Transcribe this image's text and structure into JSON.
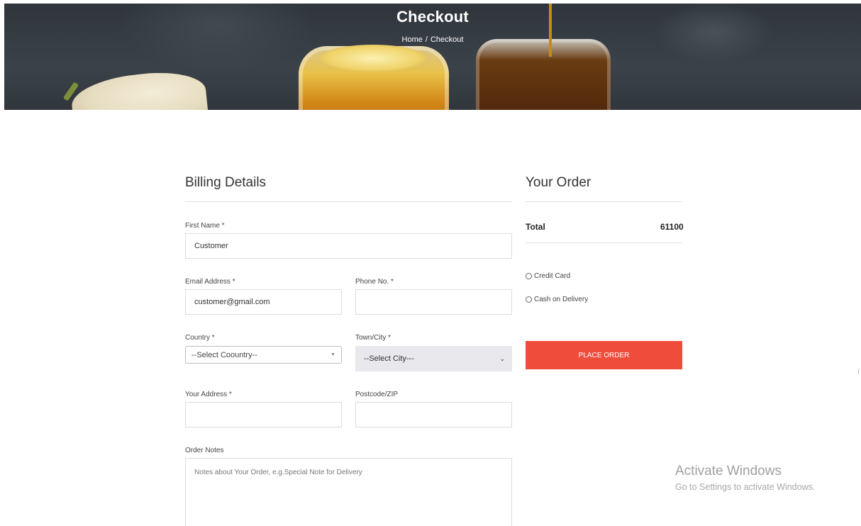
{
  "header": {
    "title": "Checkout",
    "breadcrumb": {
      "home": "Home",
      "separator": "/",
      "current": "Checkout"
    }
  },
  "billing": {
    "heading": "Billing Details",
    "first_name": {
      "label": "First Name *",
      "value": "Customer"
    },
    "email": {
      "label": "Email Address *",
      "value": "customer@gmail.com"
    },
    "phone": {
      "label": "Phone No. *",
      "value": ""
    },
    "country": {
      "label": "Country *",
      "selected": "--Select Coountry--"
    },
    "city": {
      "label": "Town/City *",
      "selected": "--Select City---"
    },
    "address": {
      "label": "Your Address *",
      "value": ""
    },
    "postcode": {
      "label": "Postcode/ZIP",
      "value": ""
    },
    "notes": {
      "label": "Order Notes",
      "placeholder": "Notes about Your Order, e.g.Special Note for Delivery"
    }
  },
  "order": {
    "heading": "Your Order",
    "total_label": "Total",
    "total_value": "61100",
    "payment_options": [
      "Credit Card",
      "Cash on Delivery"
    ],
    "place_order_label": "PLACE ORDER"
  },
  "watermark": {
    "title": "Activate Windows",
    "subtitle": "Go to Settings to activate Windows."
  },
  "colors": {
    "accent": "#f04c3c",
    "hero_bg": "#353b41"
  }
}
